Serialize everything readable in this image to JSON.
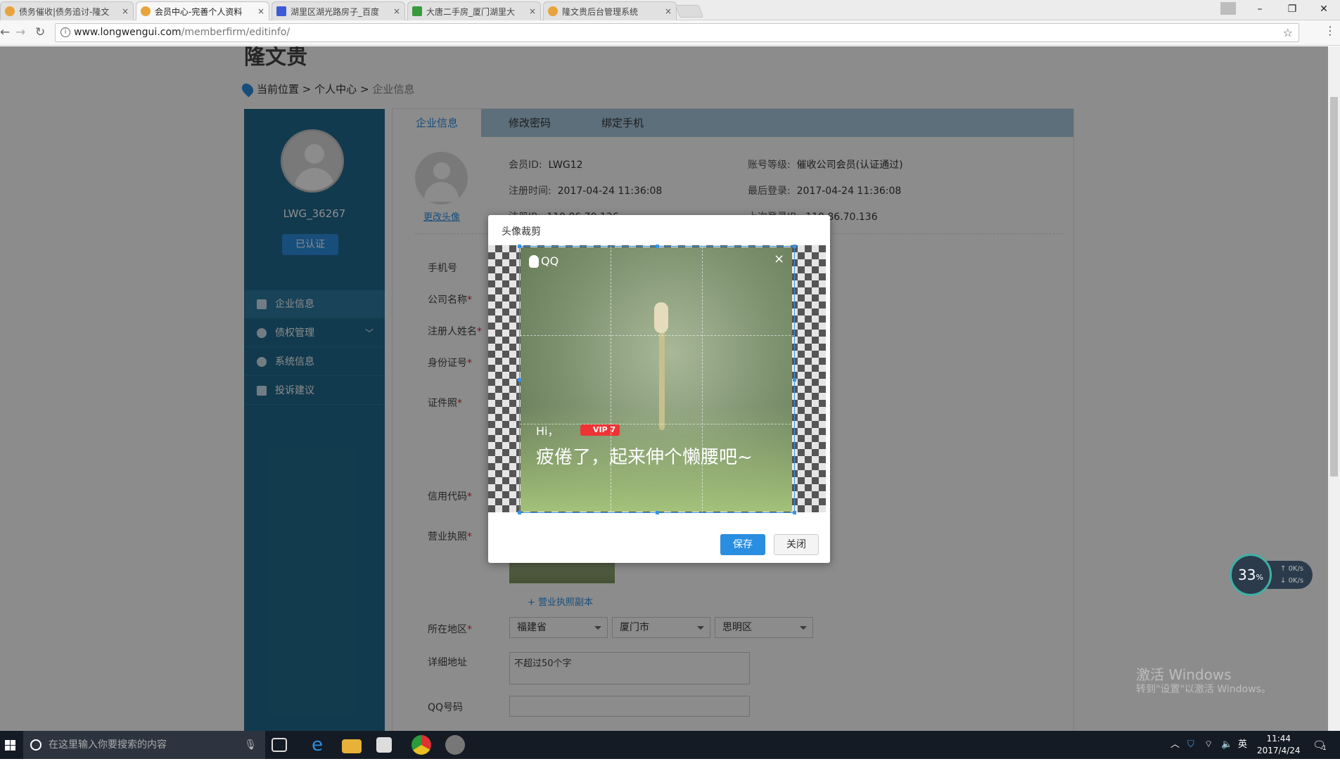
{
  "browser": {
    "tabs": [
      {
        "title": "债务催收|债务追讨-隆文",
        "active": false,
        "favicon": "coin"
      },
      {
        "title": "会员中心-完善个人资料",
        "active": true,
        "favicon": "coin"
      },
      {
        "title": "湖里区湖光路房子_百度",
        "active": false,
        "favicon": "paw"
      },
      {
        "title": "大唐二手房_厦门湖里大",
        "active": false,
        "favicon": "green-house"
      },
      {
        "title": "隆文贵后台管理系统",
        "active": false,
        "favicon": "coin"
      }
    ],
    "tab_close": "×",
    "url_host": "www.longwengui.com",
    "url_path": "/memberfirm/editinfo/",
    "window_controls": {
      "minimize": "–",
      "maximize": "❐",
      "close": "✕"
    }
  },
  "page": {
    "logo_text": "隆文贵",
    "breadcrumb": {
      "prefix": "当前位置",
      "sep1": ">",
      "level1": "个人中心",
      "sep2": ">",
      "current": "企业信息"
    },
    "sidebar": {
      "username": "LWG_36267",
      "verified_label": "已认证",
      "items": [
        {
          "label": "企业信息",
          "icon": "user-icon"
        },
        {
          "label": "债权管理",
          "icon": "globe-icon",
          "chevron": "﹀"
        },
        {
          "label": "系统信息",
          "icon": "info-icon"
        },
        {
          "label": "投诉建议",
          "icon": "edit-icon"
        }
      ]
    },
    "tabs": [
      "企业信息",
      "修改密码",
      "绑定手机"
    ],
    "change_avatar": "更改头像",
    "info": {
      "member_id_label": "会员ID:",
      "member_id": "LWG12",
      "level_label": "账号等级:",
      "level": "催收公司会员(认证通过)",
      "reg_time_label": "注册时间:",
      "reg_time": "2017-04-24 11:36:08",
      "last_login_label": "最后登录:",
      "last_login": "2017-04-24 11:36:08",
      "reg_ip_label": "注册IP:",
      "reg_ip": "110.86.70.136",
      "last_ip_label": "上次登录IP:",
      "last_ip": "110.86.70.136"
    },
    "form": {
      "phone": "手机号",
      "company": "公司名称",
      "registrant": "注册人姓名",
      "id_number": "身份证号",
      "id_photo": "证件照",
      "credit_code": "信用代码",
      "license": "营业执照",
      "add_license_copy": "+ 营业执照副本",
      "region": "所在地区",
      "province": "福建省",
      "city": "厦门市",
      "district": "思明区",
      "address": "详细地址",
      "address_placeholder": "不超过50个字",
      "qq": "QQ号码",
      "required_mark": "*"
    }
  },
  "modal": {
    "title": "头像裁剪",
    "qq_brand": "QQ",
    "qq_close": "×",
    "hi": "Hi，",
    "vip": "VIP 7",
    "message": "疲倦了，起来伸个懒腰吧~",
    "save": "保存",
    "close": "关闭"
  },
  "speed_widget": {
    "percent": "33",
    "percent_unit": "%",
    "up": "0K/s",
    "down": "0K/s"
  },
  "watermark": {
    "line1": "激活 Windows",
    "line2": "转到\"设置\"以激活 Windows。"
  },
  "taskbar": {
    "search_placeholder": "在这里输入你要搜索的内容",
    "ime": "英",
    "time": "11:44",
    "date": "2017/4/24",
    "notification_count": "1"
  }
}
